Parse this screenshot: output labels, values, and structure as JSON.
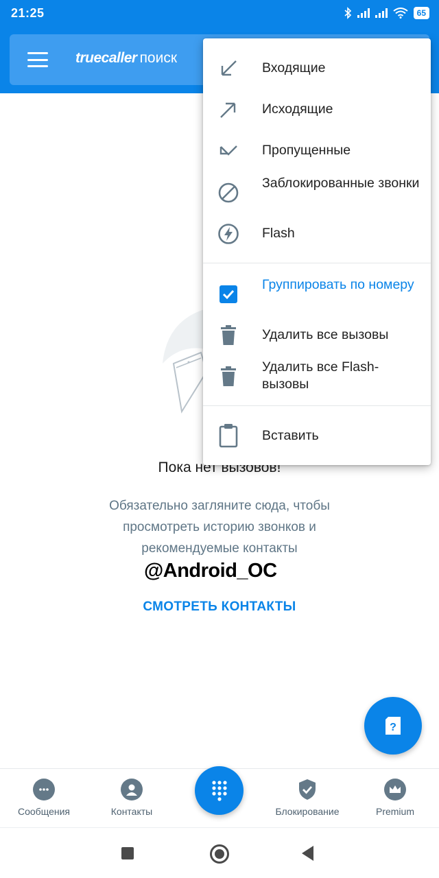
{
  "status_bar": {
    "time": "21:25",
    "battery": "65",
    "icons": [
      "bluetooth-icon",
      "signal-icon",
      "signal-icon",
      "wifi-icon",
      "battery-icon"
    ]
  },
  "app_bar": {
    "brand_logo": "truecaller",
    "brand_search": "поиск"
  },
  "empty_state": {
    "title": "Пока нет вызовов!",
    "subtitle_lines": [
      "Обязательно загляните сюда, чтобы",
      "просмотреть историю звонков и",
      "рекомендуемые контакты"
    ],
    "action": "СМОТРЕТЬ КОНТАКТЫ"
  },
  "watermark": "@Android_OC",
  "dropdown": {
    "items": [
      {
        "label": "Входящие",
        "icon": "incoming-arrow-icon"
      },
      {
        "label": "Исходящие",
        "icon": "outgoing-arrow-icon"
      },
      {
        "label": "Пропущенные",
        "icon": "missed-call-icon"
      },
      {
        "label": "Заблокированные звонки",
        "icon": "blocked-icon"
      },
      {
        "label": "Flash",
        "icon": "flash-icon"
      },
      {
        "label": "Группировать по номеру",
        "icon": "checkbox-icon",
        "checked": true
      },
      {
        "label": "Удалить все вызовы",
        "icon": "trash-icon"
      },
      {
        "label": "Удалить все Flash-вызовы",
        "icon": "trash-icon"
      },
      {
        "label": "Вставить",
        "icon": "clipboard-icon"
      }
    ]
  },
  "bottom_nav": {
    "items": [
      {
        "label": "Сообщения",
        "icon": "messages-icon"
      },
      {
        "label": "Контакты",
        "icon": "contacts-icon"
      },
      {
        "label": "Блокирование",
        "icon": "shield-icon"
      },
      {
        "label": "Premium",
        "icon": "crown-icon"
      }
    ],
    "center_icon": "dialpad-icon"
  },
  "colors": {
    "primary": "#0a84e8",
    "searchbar": "#3e9df0",
    "icon_gray": "#647988",
    "text_secondary": "#5f7686"
  }
}
